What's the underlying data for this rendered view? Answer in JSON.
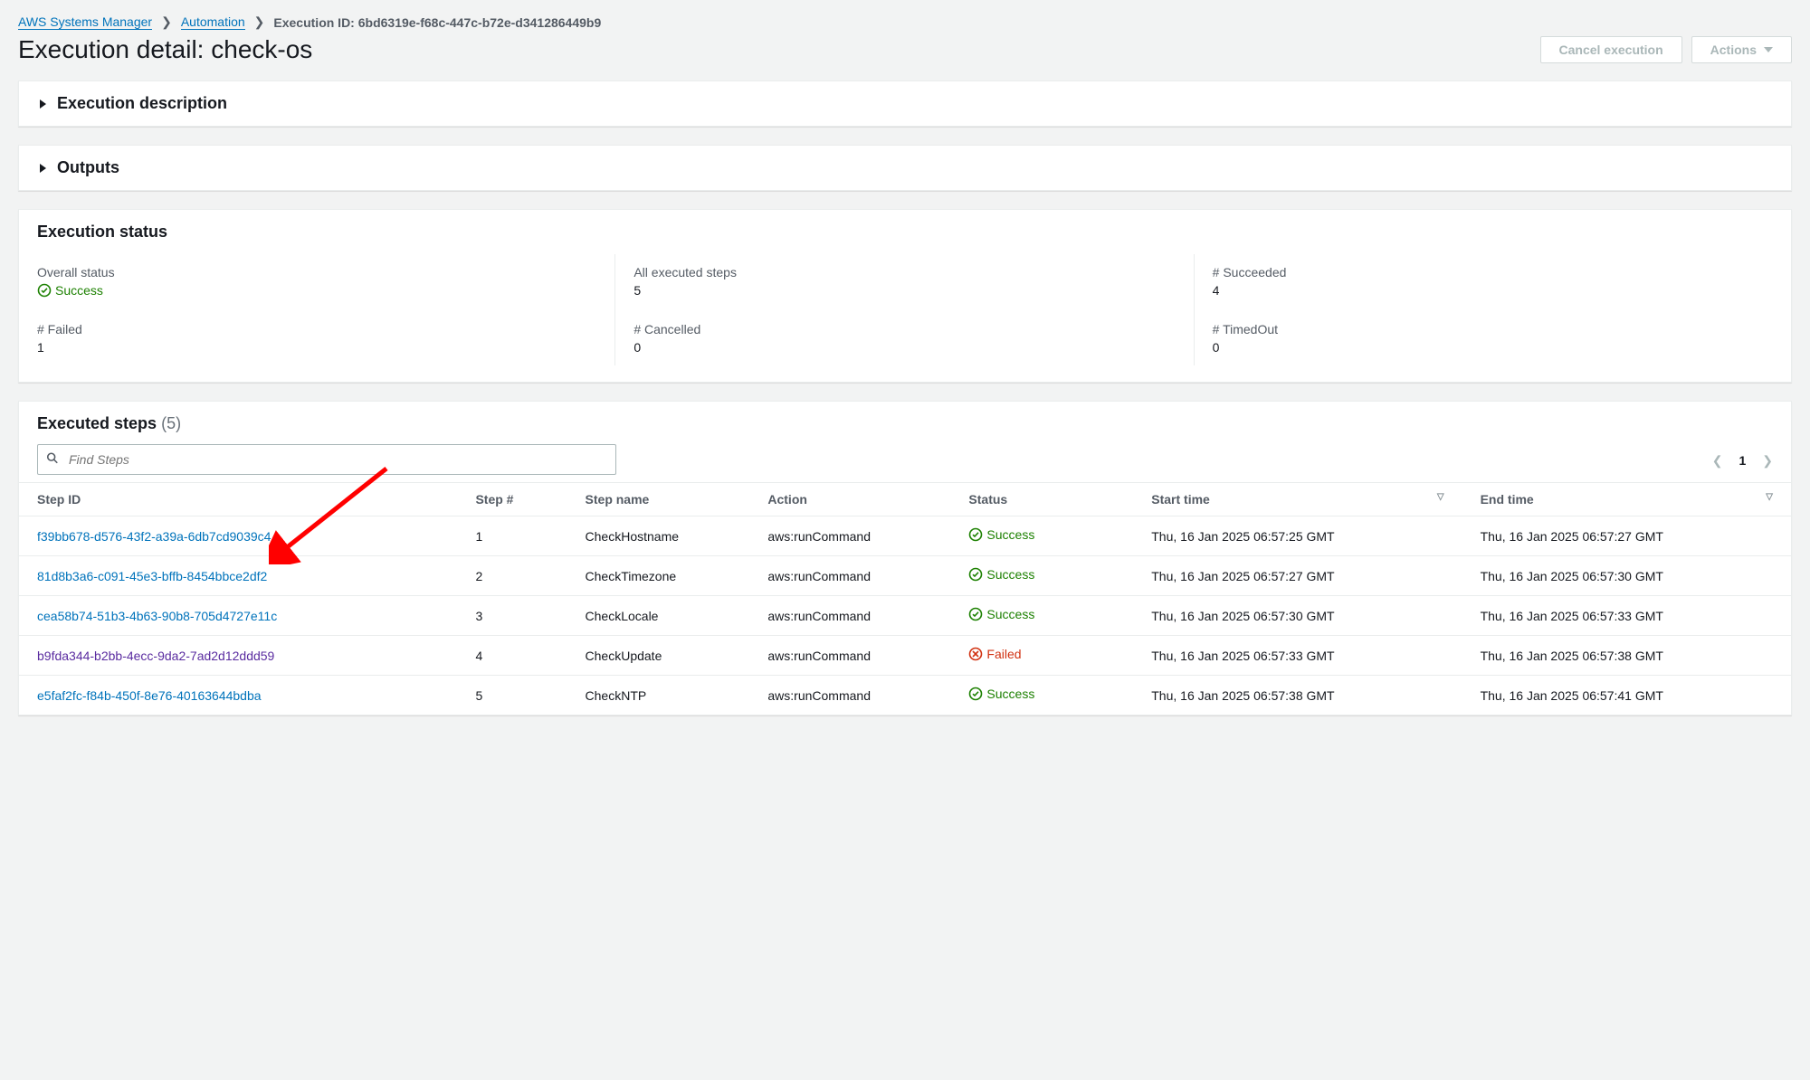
{
  "breadcrumb": {
    "root": "AWS Systems Manager",
    "second": "Automation",
    "current": "Execution ID: 6bd6319e-f68c-447c-b72e-d341286449b9"
  },
  "header": {
    "title": "Execution detail: check-os",
    "cancel_btn": "Cancel execution",
    "actions_btn": "Actions"
  },
  "panels": {
    "exec_desc_title": "Execution description",
    "outputs_title": "Outputs",
    "exec_status_title": "Execution status",
    "executed_steps_title": "Executed steps",
    "executed_steps_count": "(5)"
  },
  "status": {
    "overall_label": "Overall status",
    "overall_value": "Success",
    "all_steps_label": "All executed steps",
    "all_steps_value": "5",
    "succeeded_label": "# Succeeded",
    "succeeded_value": "4",
    "failed_label": "# Failed",
    "failed_value": "1",
    "cancelled_label": "# Cancelled",
    "cancelled_value": "0",
    "timedout_label": "# TimedOut",
    "timedout_value": "0"
  },
  "search": {
    "placeholder": "Find Steps"
  },
  "pagination": {
    "page": "1"
  },
  "columns": {
    "step_id": "Step ID",
    "step_num": "Step #",
    "step_name": "Step name",
    "action": "Action",
    "status": "Status",
    "start_time": "Start time",
    "end_time": "End time"
  },
  "rows": [
    {
      "id": "f39bb678-d576-43f2-a39a-6db7cd9039c4",
      "num": "1",
      "name": "CheckHostname",
      "action": "aws:runCommand",
      "status": "Success",
      "status_kind": "success",
      "start": "Thu, 16 Jan 2025 06:57:25 GMT",
      "end": "Thu, 16 Jan 2025 06:57:27 GMT",
      "visited": false
    },
    {
      "id": "81d8b3a6-c091-45e3-bffb-8454bbce2df2",
      "num": "2",
      "name": "CheckTimezone",
      "action": "aws:runCommand",
      "status": "Success",
      "status_kind": "success",
      "start": "Thu, 16 Jan 2025 06:57:27 GMT",
      "end": "Thu, 16 Jan 2025 06:57:30 GMT",
      "visited": false
    },
    {
      "id": "cea58b74-51b3-4b63-90b8-705d4727e11c",
      "num": "3",
      "name": "CheckLocale",
      "action": "aws:runCommand",
      "status": "Success",
      "status_kind": "success",
      "start": "Thu, 16 Jan 2025 06:57:30 GMT",
      "end": "Thu, 16 Jan 2025 06:57:33 GMT",
      "visited": false
    },
    {
      "id": "b9fda344-b2bb-4ecc-9da2-7ad2d12ddd59",
      "num": "4",
      "name": "CheckUpdate",
      "action": "aws:runCommand",
      "status": "Failed",
      "status_kind": "failed",
      "start": "Thu, 16 Jan 2025 06:57:33 GMT",
      "end": "Thu, 16 Jan 2025 06:57:38 GMT",
      "visited": true
    },
    {
      "id": "e5faf2fc-f84b-450f-8e76-40163644bdba",
      "num": "5",
      "name": "CheckNTP",
      "action": "aws:runCommand",
      "status": "Success",
      "status_kind": "success",
      "start": "Thu, 16 Jan 2025 06:57:38 GMT",
      "end": "Thu, 16 Jan 2025 06:57:41 GMT",
      "visited": false
    }
  ]
}
